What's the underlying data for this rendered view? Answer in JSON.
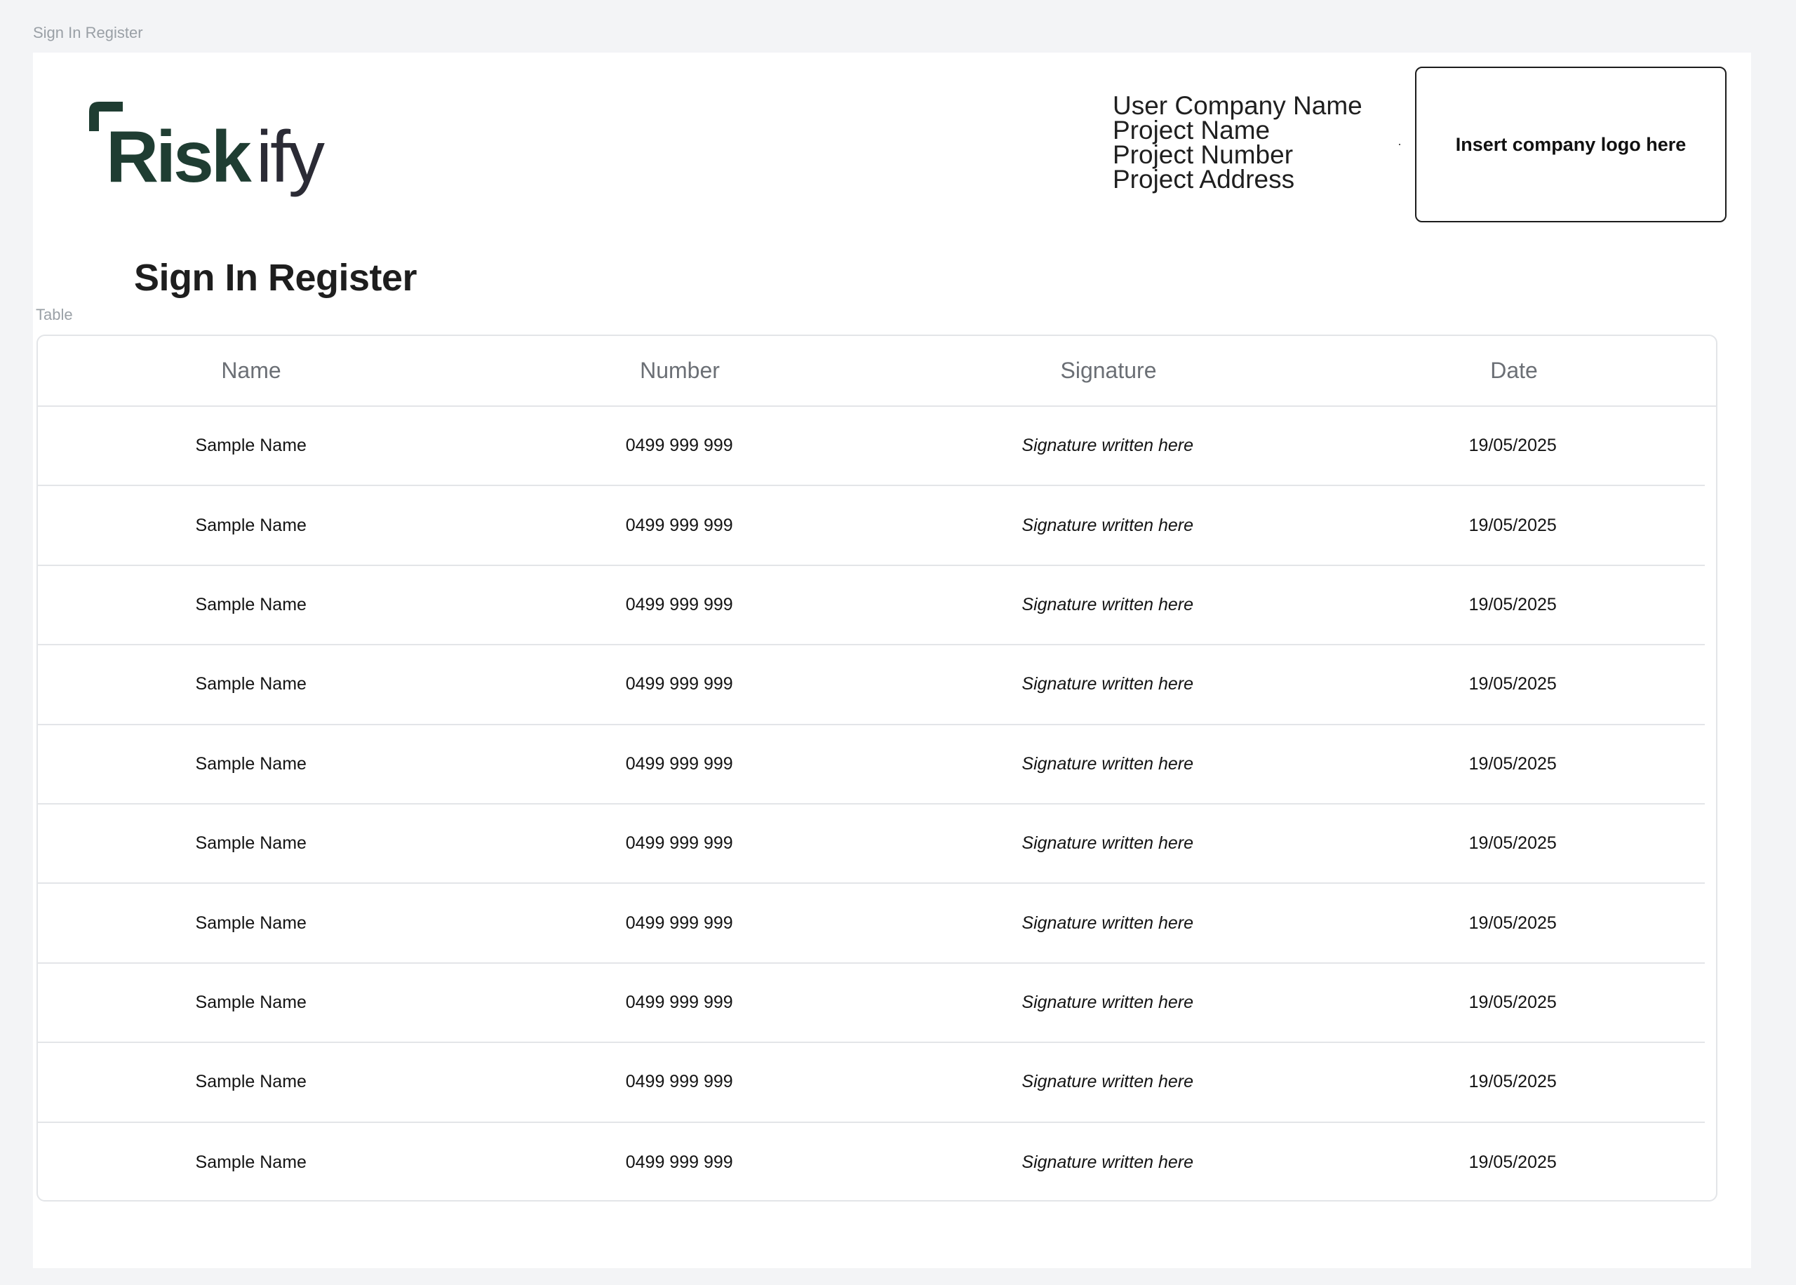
{
  "frame_label": "Sign In Register",
  "brand": {
    "logo_text": "Riskify",
    "colors": {
      "green": "#1f3d32",
      "dark": "#2b2b35"
    }
  },
  "project_info": {
    "company": "User Company Name",
    "project_name": "Project Name",
    "project_number": "Project Number",
    "project_address": "Project Address"
  },
  "logo_placeholder": "Insert company logo here",
  "title": "Sign In Register",
  "table_label": "Table",
  "table": {
    "headers": [
      "Name",
      "Number",
      "Signature",
      "Date"
    ],
    "rows": [
      {
        "name": "Sample Name",
        "number": "0499 999 999",
        "signature": "Signature written here",
        "date": "19/05/2025"
      },
      {
        "name": "Sample Name",
        "number": "0499 999 999",
        "signature": "Signature written here",
        "date": "19/05/2025"
      },
      {
        "name": "Sample Name",
        "number": "0499 999 999",
        "signature": "Signature written here",
        "date": "19/05/2025"
      },
      {
        "name": "Sample Name",
        "number": "0499 999 999",
        "signature": "Signature written here",
        "date": "19/05/2025"
      },
      {
        "name": "Sample Name",
        "number": "0499 999 999",
        "signature": "Signature written here",
        "date": "19/05/2025"
      },
      {
        "name": "Sample Name",
        "number": "0499 999 999",
        "signature": "Signature written here",
        "date": "19/05/2025"
      },
      {
        "name": "Sample Name",
        "number": "0499 999 999",
        "signature": "Signature written here",
        "date": "19/05/2025"
      },
      {
        "name": "Sample Name",
        "number": "0499 999 999",
        "signature": "Signature written here",
        "date": "19/05/2025"
      },
      {
        "name": "Sample Name",
        "number": "0499 999 999",
        "signature": "Signature written here",
        "date": "19/05/2025"
      },
      {
        "name": "Sample Name",
        "number": "0499 999 999",
        "signature": "Signature written here",
        "date": "19/05/2025"
      }
    ]
  }
}
